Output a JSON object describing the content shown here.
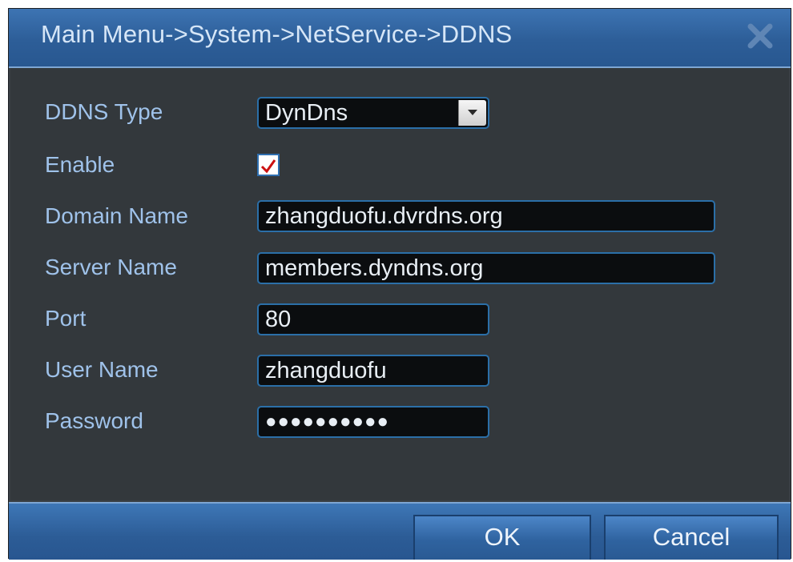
{
  "title": "Main Menu->System->NetService->DDNS",
  "fields": {
    "ddns_type_label": "DDNS Type",
    "ddns_type_value": "DynDns",
    "enable_label": "Enable",
    "enable_checked": true,
    "domain_name_label": "Domain Name",
    "domain_name_value": "zhangduofu.dvrdns.org",
    "server_name_label": "Server Name",
    "server_name_value": "members.dyndns.org",
    "port_label": "Port",
    "port_value": "80",
    "user_name_label": "User Name",
    "user_name_value": "zhangduofu",
    "password_label": "Password",
    "password_value": "●●●●●●●●●●"
  },
  "buttons": {
    "ok": "OK",
    "cancel": "Cancel"
  },
  "colors": {
    "title_bar": "#2d5e98",
    "panel": "#33383c",
    "label": "#9fc2ea",
    "field_border": "#2b6fa8",
    "check_mark": "#cc1111"
  },
  "icons": {
    "close": "close-icon",
    "dropdown": "chevron-down-icon",
    "check": "check-icon"
  }
}
